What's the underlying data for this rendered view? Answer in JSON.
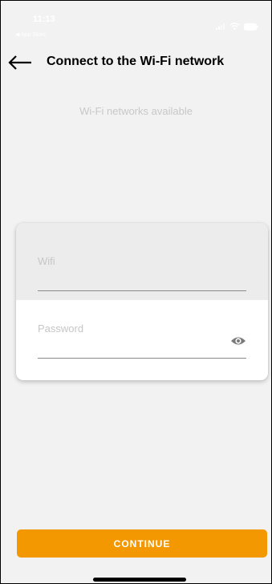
{
  "status_bar": {
    "time": "11:13",
    "back_app": "◀ App Store",
    "icons": [
      "signal-icon",
      "wifi-icon",
      "battery-icon"
    ]
  },
  "header": {
    "back_icon": "back-arrow-icon",
    "title": "Connect to the Wi-Fi network"
  },
  "networks_label": "Wi-Fi networks available",
  "form": {
    "wifi": {
      "label": "Wifi",
      "value": ""
    },
    "password": {
      "label": "Password",
      "value": "",
      "toggle_icon": "eye-icon"
    }
  },
  "continue_label": "CONTINUE",
  "colors": {
    "accent": "#f39800",
    "background": "#f2f2f2",
    "hint_text": "#c6c6c6"
  }
}
